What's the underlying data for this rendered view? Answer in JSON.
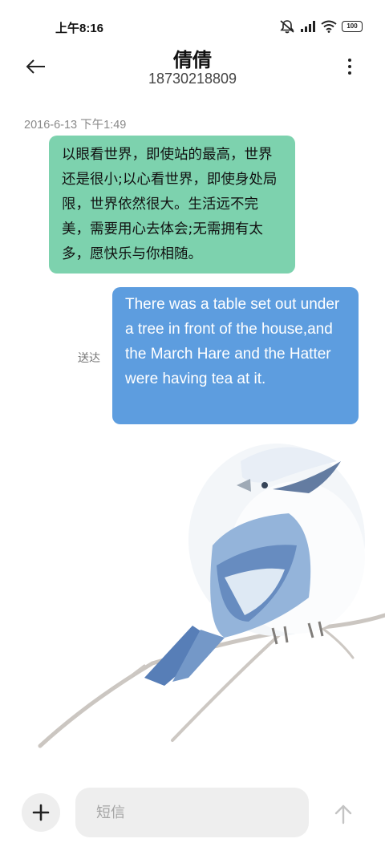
{
  "status_bar": {
    "time": "上午8:16",
    "battery": "100",
    "icons": [
      "mute-icon",
      "signal-icon",
      "wifi-icon",
      "battery-icon"
    ]
  },
  "header": {
    "contact_name": "倩倩",
    "contact_number": "18730218809",
    "icons": [
      "back-arrow-icon",
      "more-icon"
    ]
  },
  "conversation": {
    "timestamp": "2016-6-13 下午1:49",
    "messages": [
      {
        "direction": "incoming",
        "text": "以眼看世界，即使站的最高，世界还是很小;以心看世界，即使身处局限，世界依然很大。生活远不完美，需要用心去体会;无需拥有太多，愿快乐与你相随。"
      },
      {
        "direction": "outgoing",
        "text": "There was a table set out under a tree in front of the house,and the March Hare and the Hatter were having tea at it.",
        "status": "送达"
      }
    ]
  },
  "composer": {
    "placeholder": "短信",
    "value": "",
    "icons": [
      "plus-icon",
      "send-arrow-icon"
    ]
  },
  "colors": {
    "incoming_bubble": "#7dd2ae",
    "outgoing_bubble": "#5d9ddf",
    "input_background": "#eeeeee"
  }
}
